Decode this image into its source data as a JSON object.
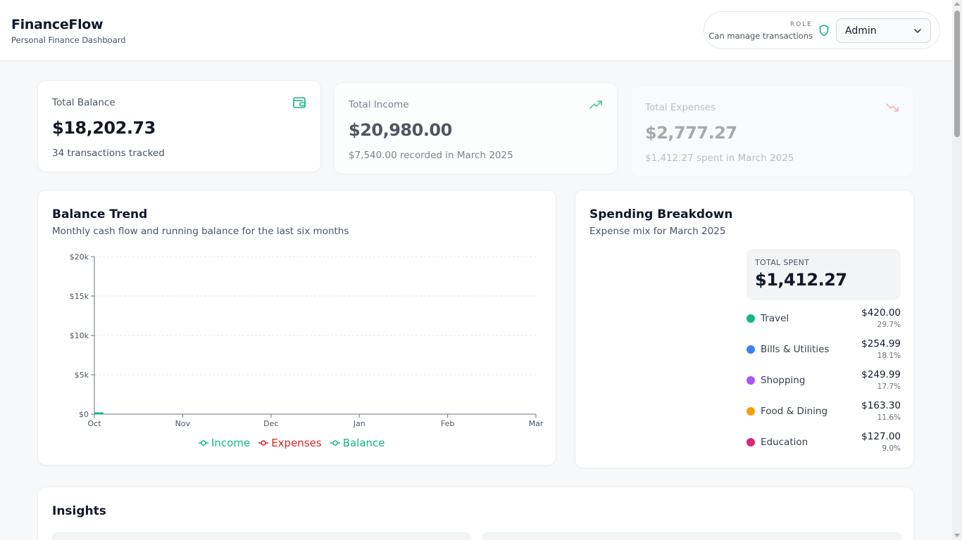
{
  "header": {
    "title": "FinanceFlow",
    "subtitle": "Personal Finance Dashboard",
    "role_label": "ROLE",
    "role_desc": "Can manage transactions",
    "role_value": "Admin"
  },
  "stats": [
    {
      "label": "Total Balance",
      "value": "$18,202.73",
      "sub": "34 transactions tracked",
      "icon": "wallet-icon",
      "color": "#10b981"
    },
    {
      "label": "Total Income",
      "value": "$20,980.00",
      "sub": "$7,540.00 recorded in March 2025",
      "icon": "trending-up-icon",
      "color": "#10b981"
    },
    {
      "label": "Total Expenses",
      "value": "$2,777.27",
      "sub": "$1,412.27 spent in March 2025",
      "icon": "trending-down-icon",
      "color": "#ef4444"
    }
  ],
  "balance_trend": {
    "title": "Balance Trend",
    "subtitle": "Monthly cash flow and running balance for the last six months"
  },
  "chart_data": {
    "type": "line",
    "categories": [
      "Oct",
      "Nov",
      "Dec",
      "Jan",
      "Feb",
      "Mar"
    ],
    "y_ticks": [
      "$0",
      "$5k",
      "$10k",
      "$15k",
      "$20k"
    ],
    "ylim": [
      0,
      20000
    ],
    "grid": true,
    "legend_position": "bottom",
    "series": [
      {
        "name": "Income",
        "color": "#10b981"
      },
      {
        "name": "Expenses",
        "color": "#dc2626"
      },
      {
        "name": "Balance",
        "color": "#10b981"
      }
    ]
  },
  "spending": {
    "title": "Spending Breakdown",
    "subtitle": "Expense mix for March 2025",
    "total_label": "TOTAL SPENT",
    "total_value": "$1,412.27",
    "categories": [
      {
        "name": "Travel",
        "amount": "$420.00",
        "pct": "29.7%",
        "color": "#10b981"
      },
      {
        "name": "Bills & Utilities",
        "amount": "$254.99",
        "pct": "18.1%",
        "color": "#3b82f6"
      },
      {
        "name": "Shopping",
        "amount": "$249.99",
        "pct": "17.7%",
        "color": "#a855f7"
      },
      {
        "name": "Food & Dining",
        "amount": "$163.30",
        "pct": "11.6%",
        "color": "#f59e0b"
      },
      {
        "name": "Education",
        "amount": "$127.00",
        "pct": "9.0%",
        "color": "#db2777"
      }
    ]
  },
  "insights": {
    "title": "Insights"
  }
}
